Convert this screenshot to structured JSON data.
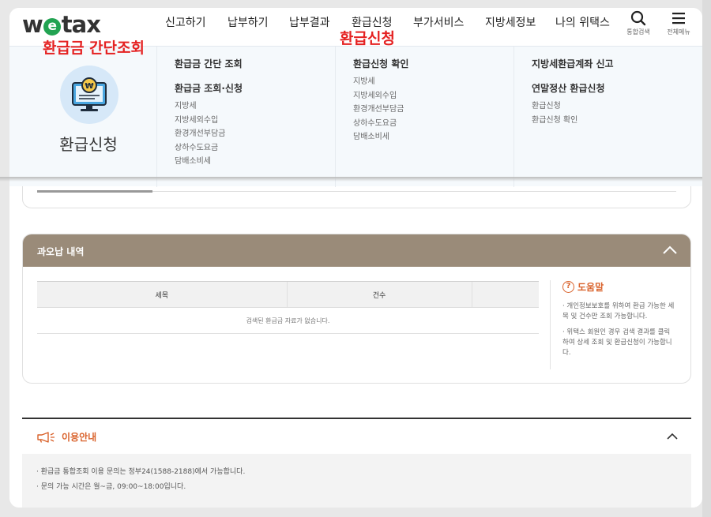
{
  "header": {
    "logo": {
      "pre": "w",
      "mid": "e",
      "post": "tax"
    },
    "nav": [
      "신고하기",
      "납부하기",
      "납부결과",
      "환급신청",
      "부가서비스",
      "지방세정보",
      "나의 위택스"
    ],
    "tools": {
      "search": "통합검색",
      "menu": "전체메뉴"
    }
  },
  "annotations": {
    "left": "환급금 간단조회",
    "right": "환급신청"
  },
  "mega": {
    "title": "환급신청",
    "col1": {
      "h1": "환급금 간단 조회",
      "h2": "환급금 조회·신청",
      "items": [
        "지방세",
        "지방세외수입",
        "환경개선부담금",
        "상하수도요금",
        "담배소비세"
      ]
    },
    "col2": {
      "h1": "환급신청 확인",
      "items": [
        "지방세",
        "지방세외수입",
        "환경개선부담금",
        "상하수도요금",
        "담배소비세"
      ]
    },
    "col3": {
      "h1": "지방세환급계좌 신고",
      "h2": "연말정산 환급신청",
      "items": [
        "환급신청",
        "환급신청 확인"
      ]
    }
  },
  "overpay": {
    "title": "과오납 내역",
    "columns": [
      "세목",
      "건수",
      ""
    ],
    "empty": "검색된 환급금 자료가 없습니다."
  },
  "help": {
    "title": "도움말",
    "lines": [
      "· 개인정보보호를 위하여 환급 가능한 세목 및 건수만 조회 가능합니다.",
      "· 위택스 회원인 경우 검색 결과를 클릭하여 상세 조회 및 환급신청이 가능합니다."
    ]
  },
  "info": {
    "title": "이용안내",
    "lines": [
      "· 환급금 통합조회 이용 문의는 정부24(1588-2188)에서 가능합니다.",
      "· 문의 가능 시간은 월~금, 09:00~18:00입니다."
    ]
  },
  "colors": {
    "brand_green": "#22a352",
    "accent_orange": "#d9622b",
    "header_brown": "#9a8b79",
    "annotation_red": "#e52222"
  }
}
